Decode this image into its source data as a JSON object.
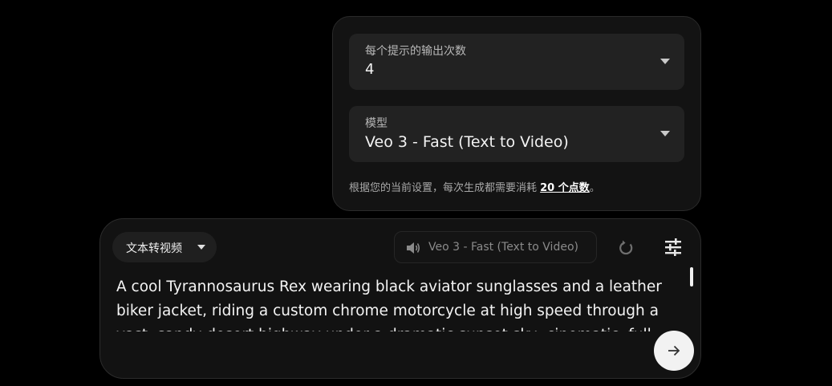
{
  "settings": {
    "outputs_label": "每个提示的输出次数",
    "outputs_value": "4",
    "model_label": "模型",
    "model_value": "Veo 3 - Fast (Text to Video)",
    "cost_prefix": "根据您的当前设置，每次生成都需要消耗 ",
    "cost_link": "20 个点数",
    "cost_suffix": "。"
  },
  "composer": {
    "mode_label": "文本转视频",
    "model_chip_label": "Veo 3 - Fast (Text to Video)",
    "prompt_text": "A cool Tyrannosaurus Rex wearing black aviator sunglasses and a leather biker jacket, riding a custom chrome motorcycle at high speed through a vast, sandy desert highway under a dramatic sunset sky, cinematic, full-length shot"
  },
  "icons": {
    "mode_caret": "caret-down-icon",
    "speaker": "speaker-icon",
    "refresh": "refresh-icon",
    "tune": "tune-sliders-icon",
    "send": "arrow-right-icon"
  }
}
